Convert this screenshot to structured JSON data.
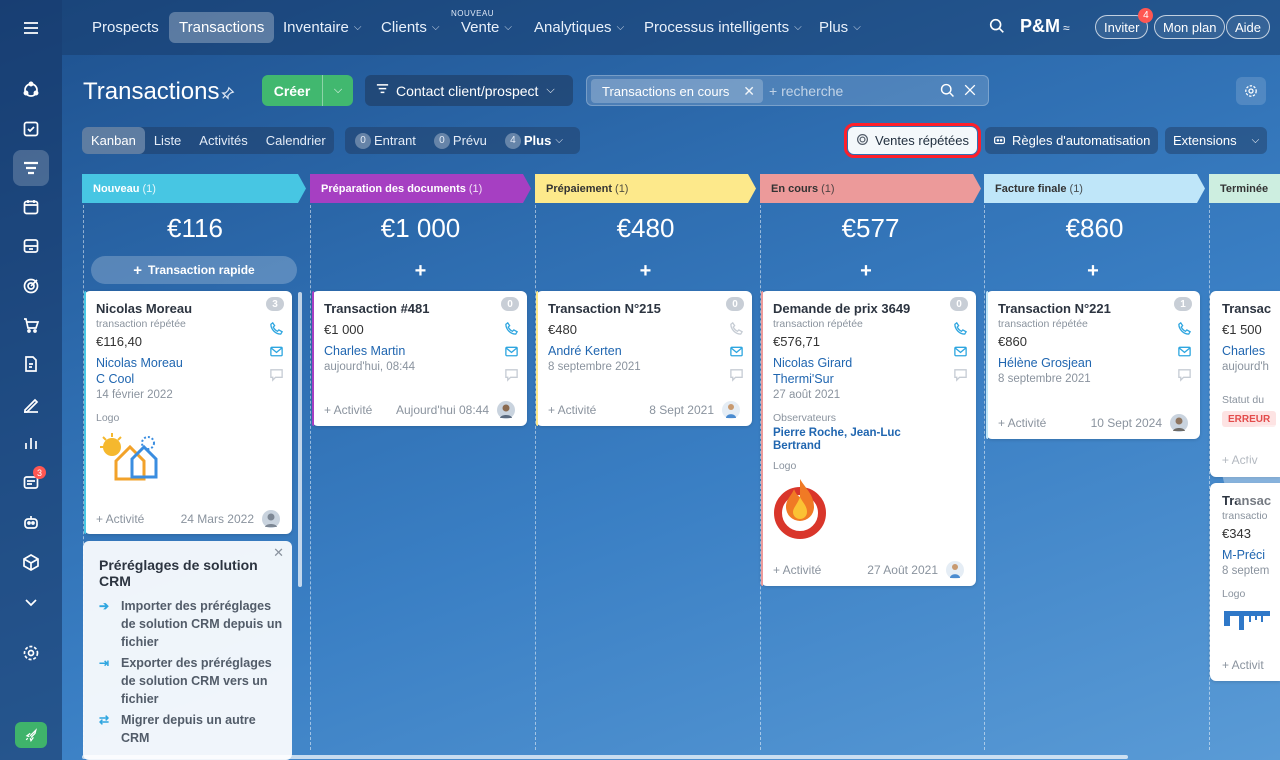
{
  "topnav": {
    "items": [
      {
        "label": "Prospects",
        "dropdown": false
      },
      {
        "label": "Transactions",
        "dropdown": false,
        "active": true
      },
      {
        "label": "Inventaire",
        "dropdown": true
      },
      {
        "label": "Clients",
        "dropdown": true
      },
      {
        "label": "Vente",
        "dropdown": true,
        "tag": "NOUVEAU"
      },
      {
        "label": "Analytiques",
        "dropdown": true
      },
      {
        "label": "Processus intelligents",
        "dropdown": true
      },
      {
        "label": "Plus",
        "dropdown": true
      }
    ],
    "brand": "P&M",
    "invite_label": "Inviter",
    "invite_badge": "4",
    "plan_label": "Mon plan",
    "help_label": "Aide"
  },
  "rail": {
    "messages_badge": "3"
  },
  "header": {
    "title": "Transactions",
    "create_label": "Créer",
    "contact_label": "Contact client/prospect",
    "filter_chip": "Transactions en cours",
    "search_placeholder": "+ recherche"
  },
  "views": {
    "tabs": [
      "Kanban",
      "Liste",
      "Activités",
      "Calendrier"
    ],
    "active": "Kanban",
    "counters": [
      {
        "count": "0",
        "label": "Entrant"
      },
      {
        "count": "0",
        "label": "Prévu"
      },
      {
        "count": "4",
        "label": "Plus"
      }
    ],
    "repeat_sales_label": "Ventes répétées",
    "automation_label": "Règles d'automatisation",
    "extensions_label": "Extensions"
  },
  "quick_add_label": "Transaction rapide",
  "columns": [
    {
      "name": "Nouveau",
      "count": "(1)",
      "total": "€116",
      "color": "#47c6e3"
    },
    {
      "name": "Préparation des documents",
      "count": "(1)",
      "total": "€1 000",
      "color": "#a63fc2"
    },
    {
      "name": "Prépaiement",
      "count": "(1)",
      "total": "€480",
      "color": "#fde98b"
    },
    {
      "name": "En cours",
      "count": "(1)",
      "total": "€577",
      "color": "#ec9a9a"
    },
    {
      "name": "Facture finale",
      "count": "(1)",
      "total": "€860",
      "color": "#bfe6f9"
    },
    {
      "name": "Terminée",
      "count": "",
      "total": "",
      "color": "#cdeee0"
    }
  ],
  "cards": {
    "c1": {
      "title": "Nicolas Moreau",
      "count": "3",
      "sub": "transaction répétée",
      "amount": "€116,40",
      "contact": "Nicolas Moreau",
      "company": "C Cool",
      "date": "14 février 2022",
      "logo_label": "Logo",
      "activity": "+ Activité",
      "foot_date": "24 Mars 2022"
    },
    "c2": {
      "title": "Transaction #481",
      "count": "0",
      "amount": "€1 000",
      "contact": "Charles Martin",
      "date": "aujourd'hui, 08:44",
      "activity": "+ Activité",
      "foot_date": "Aujourd'hui 08:44"
    },
    "c3": {
      "title": "Transaction N°215",
      "count": "0",
      "amount": "€480",
      "contact": "André Kerten",
      "date": "8 septembre 2021",
      "activity": "+ Activité",
      "foot_date": "8 Sept 2021"
    },
    "c4": {
      "title": "Demande de prix 3649",
      "count": "0",
      "sub": "transaction répétée",
      "amount": "€576,71",
      "contact": "Nicolas Girard",
      "company": "Thermi'Sur",
      "date": "27 août 2021",
      "observers_label": "Observateurs",
      "observers": "Pierre Roche, Jean-Luc Bertrand",
      "logo_label": "Logo",
      "activity": "+ Activité",
      "foot_date": "27 Août 2021"
    },
    "c5": {
      "title": "Transaction N°221",
      "count": "1",
      "sub": "transaction répétée",
      "amount": "€860",
      "contact": "Hélène Grosjean",
      "date": "8 septembre 2021",
      "activity": "+ Activité",
      "foot_date": "10 Sept 2024"
    },
    "c6": {
      "title": "Transac",
      "amount": "€1 500",
      "contact": "Charles",
      "date": "aujourd'h",
      "status_label": "Statut du",
      "status": "ERREUR",
      "activity": "+ Activ"
    },
    "c7": {
      "title": "Transac",
      "sub": "transactio",
      "amount": "€343",
      "contact": "M-Préci",
      "date": "8 septem",
      "logo_label": "Logo",
      "activity": "+ Activit"
    }
  },
  "presets": {
    "title": "Préréglages de solution CRM",
    "items": [
      "Importer des préréglages de solution CRM depuis un fichier",
      "Exporter des préréglages de solution CRM vers un fichier",
      "Migrer depuis un autre CRM"
    ]
  }
}
